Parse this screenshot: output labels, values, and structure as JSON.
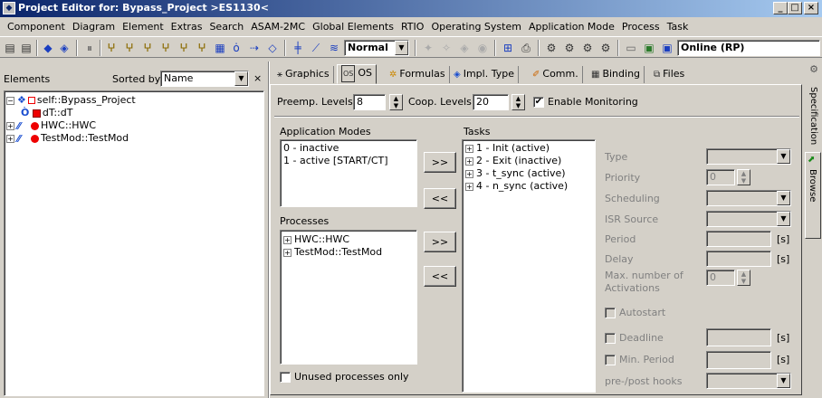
{
  "window": {
    "title": "Project Editor for: Bypass_Project >ES1130<",
    "minimize": "_",
    "maximize": "□",
    "close": "×"
  },
  "menu": [
    "Component",
    "Diagram",
    "Element",
    "Extras",
    "Search",
    "ASAM-2MC",
    "Global Elements",
    "RTIO",
    "Operating System",
    "Application Mode",
    "Process",
    "Task"
  ],
  "toolbar": {
    "mode_value": "Normal",
    "online_label": "Online (RP)"
  },
  "left": {
    "elements_label": "Elements",
    "sorted_label": "Sorted by",
    "sort_value": "Name",
    "close": "×",
    "tree": [
      {
        "label": "self::Bypass_Project"
      },
      {
        "label": "dT::dT"
      },
      {
        "label": "HWC::HWC"
      },
      {
        "label": "TestMod::TestMod"
      }
    ]
  },
  "tabs": [
    "Graphics",
    "OS",
    "Formulas",
    "Impl. Type",
    "Comm.",
    "Binding",
    "Files"
  ],
  "os": {
    "preemp_label": "Preemp. Levels",
    "preemp_value": "8",
    "coop_label": "Coop. Levels",
    "coop_value": "20",
    "enable_monitoring": "Enable Monitoring",
    "app_modes_label": "Application Modes",
    "app_modes": [
      "0 - inactive",
      "1 - active [START/CT]"
    ],
    "processes_label": "Processes",
    "processes": [
      "HWC::HWC",
      "TestMod::TestMod"
    ],
    "tasks_label": "Tasks",
    "tasks": [
      "1 - Init (active)",
      "2 - Exit (inactive)",
      "3 - t_sync (active)",
      "4 - n_sync (active)"
    ],
    "add_btn": ">>",
    "remove_btn": "<<",
    "unused_only": "Unused processes only"
  },
  "props": {
    "type": "Type",
    "priority": "Priority",
    "priority_value": "0",
    "scheduling": "Scheduling",
    "isr_source": "ISR Source",
    "period": "Period",
    "delay": "Delay",
    "max_activations": "Max. number of",
    "max_activations2": "Activations",
    "max_act_value": "0",
    "autostart": "Autostart",
    "deadline": "Deadline",
    "min_period": "Min. Period",
    "hooks": "pre-/post hooks",
    "unit": "[s]"
  },
  "side_tabs": {
    "specification": "Specification",
    "browse": "Browse"
  }
}
